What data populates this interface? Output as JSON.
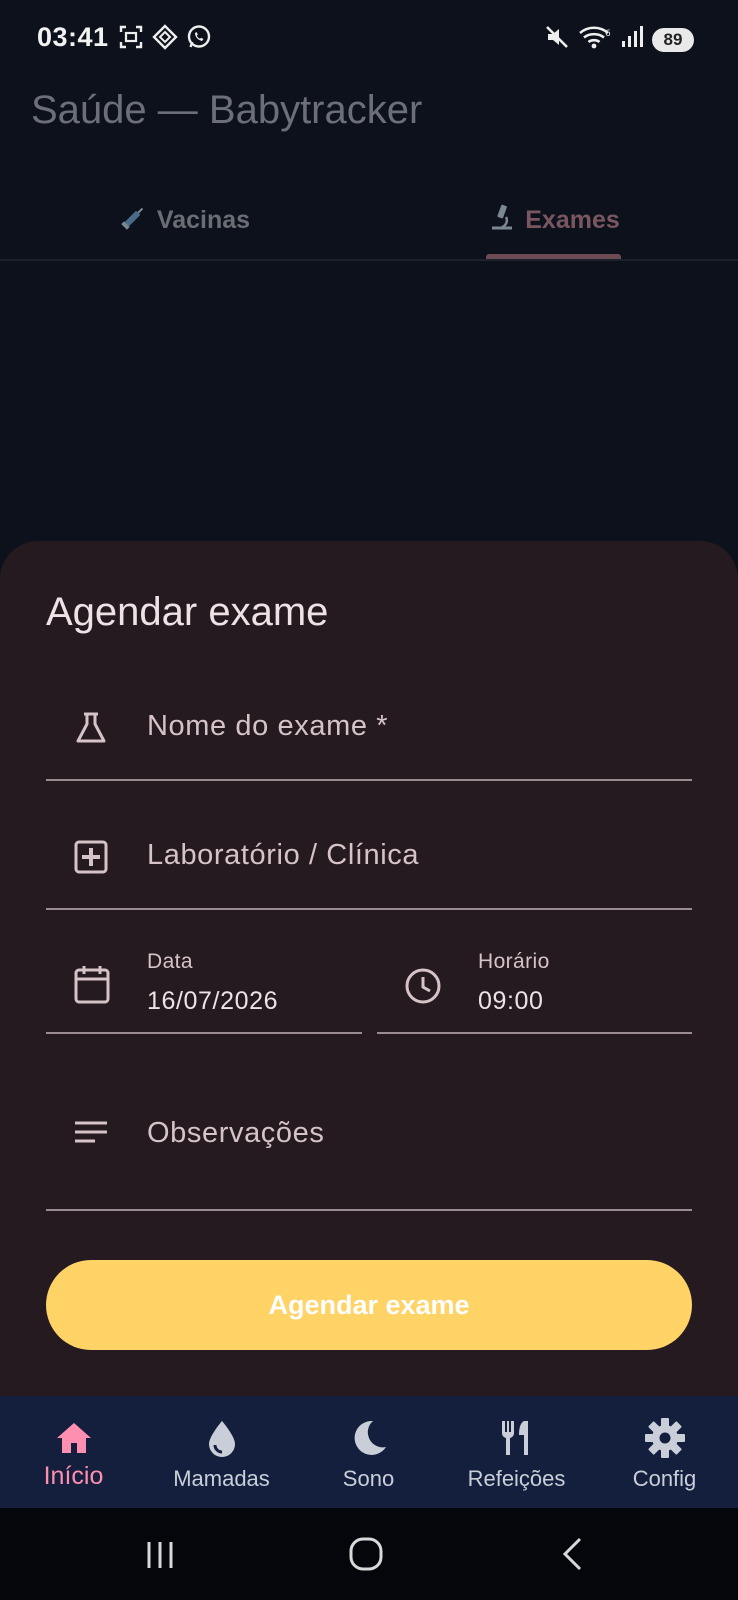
{
  "status_bar": {
    "time": "03:41",
    "battery": "89",
    "left_icons": [
      "screenshot-icon",
      "app-diamond-icon",
      "whatsapp-icon"
    ],
    "right_icons": [
      "mute-icon",
      "wifi-icon",
      "signal-icon",
      "battery-icon"
    ]
  },
  "app": {
    "title": "Saúde — Babytracker",
    "tabs": [
      {
        "label": "Vacinas",
        "icon": "syringe-icon",
        "selected": false
      },
      {
        "label": "Exames",
        "icon": "microscope-icon",
        "selected": true
      }
    ]
  },
  "sheet": {
    "title": "Agendar exame",
    "fields": {
      "exam_name": {
        "placeholder": "Nome do exame *",
        "icon": "flask-icon"
      },
      "lab": {
        "placeholder": "Laboratório / Clínica",
        "icon": "medical-plus-icon"
      },
      "date": {
        "label": "Data",
        "value": "16/07/2026",
        "icon": "calendar-icon"
      },
      "time": {
        "label": "Horário",
        "value": "09:00",
        "icon": "clock-icon"
      },
      "notes": {
        "placeholder": "Observações",
        "icon": "notes-icon"
      }
    },
    "submit_label": "Agendar exame"
  },
  "bottom_nav": {
    "items": [
      {
        "label": "Início",
        "icon": "home-icon",
        "active": true
      },
      {
        "label": "Mamadas",
        "icon": "drop-icon",
        "active": false
      },
      {
        "label": "Sono",
        "icon": "moon-icon",
        "active": false
      },
      {
        "label": "Refeições",
        "icon": "cutlery-icon",
        "active": false
      },
      {
        "label": "Config",
        "icon": "gear-icon",
        "active": false
      }
    ]
  },
  "system_nav": [
    "recents-button",
    "home-button",
    "back-button"
  ],
  "colors": {
    "background": "#0c111b",
    "sheet": "#241a1f",
    "accent_button": "#ffd366",
    "active_nav": "#ff8fb0",
    "nav_bar": "#131f3d"
  }
}
